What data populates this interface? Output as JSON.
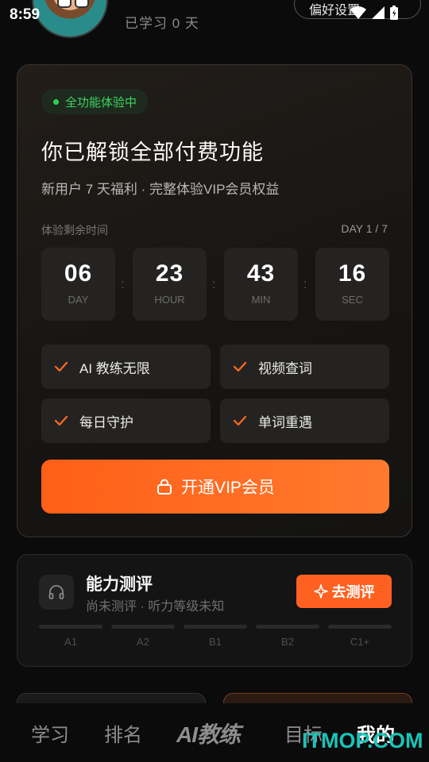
{
  "status_bar": {
    "time": "8:59"
  },
  "header": {
    "study_days": "已学习 0 天",
    "pref_button": "偏好设置"
  },
  "vip_card": {
    "badge": "全功能体验中",
    "title": "你已解锁全部付费功能",
    "subtitle": "新用户 7 天福利 · 完整体验VIP会员权益",
    "remain_label": "体验剩余时间",
    "day_counter": "DAY 1 / 7",
    "countdown": [
      {
        "value": "06",
        "unit": "DAY"
      },
      {
        "value": "23",
        "unit": "HOUR"
      },
      {
        "value": "43",
        "unit": "MIN"
      },
      {
        "value": "16",
        "unit": "SEC"
      }
    ],
    "features": [
      "AI 教练无限",
      "视频查词",
      "每日守护",
      "单词重遇"
    ],
    "cta": "开通VIP会员",
    "colors": {
      "accent": "#ff6a1f",
      "badge_green": "#2fd052"
    }
  },
  "ability": {
    "title": "能力测评",
    "subtitle": "尚未测评 · 听力等级未知",
    "button": "去测评",
    "levels": [
      "A1",
      "A2",
      "B1",
      "B2",
      "C1+"
    ],
    "icon": "headphones-icon"
  },
  "bottom_nav": {
    "items": [
      "学习",
      "排名",
      "AI教练",
      "目标",
      "我的"
    ],
    "active": "我的"
  },
  "watermark": "ITMOP.COM"
}
